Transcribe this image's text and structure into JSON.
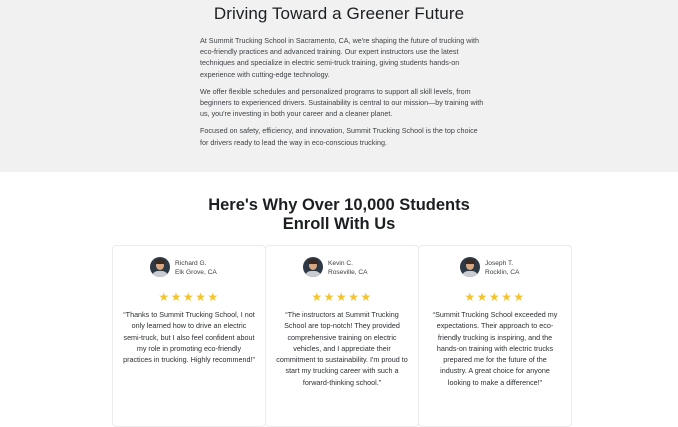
{
  "greener": {
    "title": "Driving Toward a Greener Future",
    "paragraphs": [
      "At Summit Trucking School in Sacramento, CA, we're shaping the future of trucking with eco-friendly practices and advanced training. Our expert instructors use the latest techniques and specialize in electric semi-truck training, giving students hands-on experience with cutting-edge technology.",
      "We offer flexible schedules and personalized programs to support all skill levels, from beginners to experienced drivers. Sustainability is central to our mission—by training with us, you're investing in both your career and a cleaner planet.",
      "Focused on safety, efficiency, and innovation, Summit Trucking School is the top choice for drivers ready to lead the way in eco-conscious trucking."
    ]
  },
  "testimonials": {
    "heading_line1": "Here's Why Over 10,000 Students",
    "heading_line2": "Enroll With Us",
    "star_color": "#f4c430",
    "stars": "★★★★★",
    "rating": 5,
    "items": [
      {
        "name": "Richard G.",
        "location": "Elk Grove, CA",
        "quote": "“Thanks to Summit Trucking School, I not only learned how to drive an electric semi-truck, but I also feel confident about my role in promoting eco-friendly practices in trucking. Highly recommend!”"
      },
      {
        "name": "Kevin C.",
        "location": "Roseville, CA",
        "quote": "“The instructors at Summit Trucking School are top-notch! They provided comprehensive training on electric vehicles, and I appreciate their commitment to sustainability. I'm proud to start my trucking career with such a forward-thinking school.”"
      },
      {
        "name": "Joseph T.",
        "location": "Rocklin, CA",
        "quote": "“Summit Trucking School exceeded my expectations. Their approach to eco-friendly trucking is inspiring, and the hands-on training with electric trucks prepared me for the future of the industry. A great choice for anyone looking to make a difference!”"
      }
    ]
  }
}
